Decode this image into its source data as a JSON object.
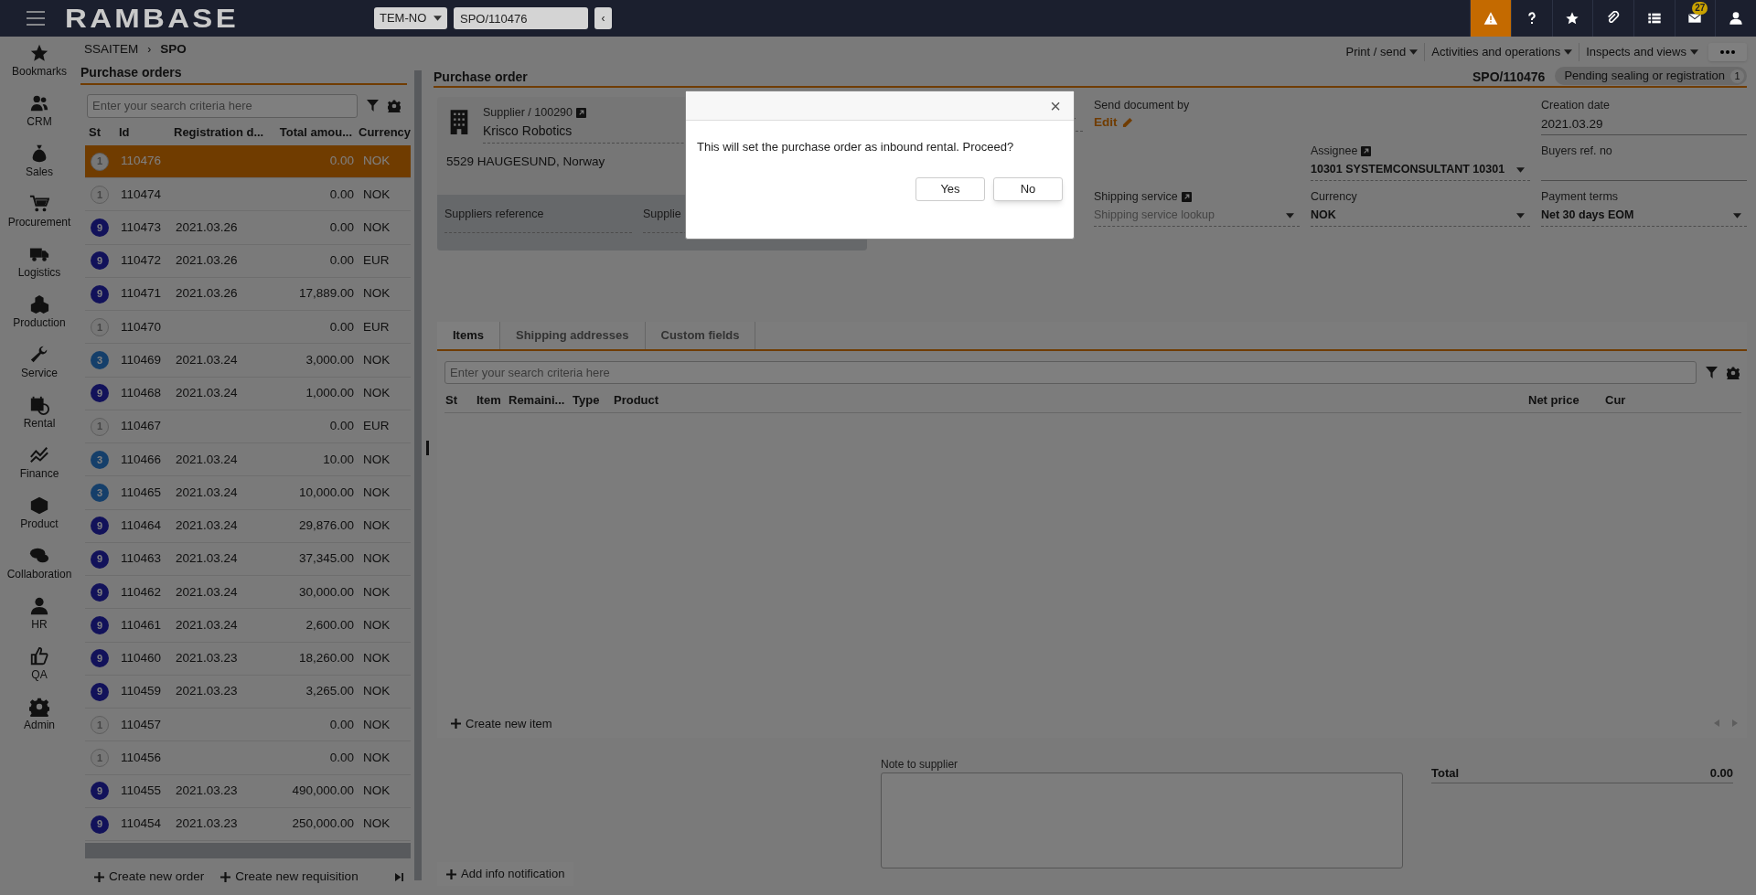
{
  "header": {
    "logo": "RAMBASE",
    "company": "TEM-NO",
    "document_field": "SPO/110476",
    "collapse_button": "‹",
    "toolbar": [
      {
        "kind": "alert",
        "selected": true
      },
      {
        "kind": "help",
        "selected": false
      },
      {
        "kind": "star",
        "selected": false
      },
      {
        "kind": "clip",
        "selected": false
      },
      {
        "kind": "list",
        "selected": false
      },
      {
        "kind": "mail",
        "selected": false,
        "badge": "27"
      },
      {
        "kind": "user",
        "selected": false
      }
    ]
  },
  "sidebar": [
    {
      "label": "Bookmarks",
      "kind": "star"
    },
    {
      "label": "CRM",
      "kind": "people"
    },
    {
      "label": "Sales",
      "kind": "money"
    },
    {
      "label": "Procurement",
      "kind": "cart"
    },
    {
      "label": "Logistics",
      "kind": "truck"
    },
    {
      "label": "Production",
      "kind": "boxes"
    },
    {
      "label": "Service",
      "kind": "wrench"
    },
    {
      "label": "Rental",
      "kind": "calendar"
    },
    {
      "label": "Finance",
      "kind": "chart"
    },
    {
      "label": "Product",
      "kind": "cube"
    },
    {
      "label": "Collaboration",
      "kind": "chat"
    },
    {
      "label": "HR",
      "kind": "person"
    },
    {
      "label": "QA",
      "kind": "thumb"
    },
    {
      "label": "Admin",
      "kind": "gear"
    }
  ],
  "breadcrumb": [
    "SSAITEM",
    "SPO"
  ],
  "breadcrumb_separator": "›",
  "list": {
    "title": "Purchase orders",
    "search_placeholder": "Enter your search criteria here",
    "columns": [
      "St",
      "Id",
      "Registration d...",
      "Total amou...",
      "Currency"
    ],
    "rows": [
      {
        "status": "1",
        "id": "110476",
        "date": "",
        "amount": "0.00",
        "currency": "NOK",
        "selected": true
      },
      {
        "status": "1",
        "id": "110474",
        "date": "",
        "amount": "0.00",
        "currency": "NOK",
        "selected": false
      },
      {
        "status": "9",
        "id": "110473",
        "date": "2021.03.26",
        "amount": "0.00",
        "currency": "NOK",
        "selected": false
      },
      {
        "status": "9",
        "id": "110472",
        "date": "2021.03.26",
        "amount": "0.00",
        "currency": "EUR",
        "selected": false
      },
      {
        "status": "9",
        "id": "110471",
        "date": "2021.03.26",
        "amount": "17,889.00",
        "currency": "NOK",
        "selected": false
      },
      {
        "status": "1",
        "id": "110470",
        "date": "",
        "amount": "0.00",
        "currency": "EUR",
        "selected": false
      },
      {
        "status": "3",
        "id": "110469",
        "date": "2021.03.24",
        "amount": "3,000.00",
        "currency": "NOK",
        "selected": false
      },
      {
        "status": "9",
        "id": "110468",
        "date": "2021.03.24",
        "amount": "1,000.00",
        "currency": "NOK",
        "selected": false
      },
      {
        "status": "1",
        "id": "110467",
        "date": "",
        "amount": "0.00",
        "currency": "EUR",
        "selected": false
      },
      {
        "status": "3",
        "id": "110466",
        "date": "2021.03.24",
        "amount": "10.00",
        "currency": "NOK",
        "selected": false
      },
      {
        "status": "3",
        "id": "110465",
        "date": "2021.03.24",
        "amount": "10,000.00",
        "currency": "NOK",
        "selected": false
      },
      {
        "status": "9",
        "id": "110464",
        "date": "2021.03.24",
        "amount": "29,876.00",
        "currency": "NOK",
        "selected": false
      },
      {
        "status": "9",
        "id": "110463",
        "date": "2021.03.24",
        "amount": "37,345.00",
        "currency": "NOK",
        "selected": false
      },
      {
        "status": "9",
        "id": "110462",
        "date": "2021.03.24",
        "amount": "30,000.00",
        "currency": "NOK",
        "selected": false
      },
      {
        "status": "9",
        "id": "110461",
        "date": "2021.03.24",
        "amount": "2,600.00",
        "currency": "NOK",
        "selected": false
      },
      {
        "status": "9",
        "id": "110460",
        "date": "2021.03.23",
        "amount": "18,260.00",
        "currency": "NOK",
        "selected": false
      },
      {
        "status": "9",
        "id": "110459",
        "date": "2021.03.23",
        "amount": "3,265.00",
        "currency": "NOK",
        "selected": false
      },
      {
        "status": "1",
        "id": "110457",
        "date": "",
        "amount": "0.00",
        "currency": "NOK",
        "selected": false
      },
      {
        "status": "1",
        "id": "110456",
        "date": "",
        "amount": "0.00",
        "currency": "NOK",
        "selected": false
      },
      {
        "status": "9",
        "id": "110455",
        "date": "2021.03.23",
        "amount": "490,000.00",
        "currency": "NOK",
        "selected": false
      },
      {
        "status": "9",
        "id": "110454",
        "date": "2021.03.23",
        "amount": "250,000.00",
        "currency": "NOK",
        "selected": false
      }
    ],
    "actions": [
      "Create new order",
      "Create new requisition"
    ]
  },
  "page_actions": [
    "Print / send",
    "Activities and operations",
    "Inspects and views"
  ],
  "document": {
    "title": "Purchase order",
    "number": "SPO/110476",
    "status": "Pending sealing or registration",
    "status_count": "1"
  },
  "supplier": {
    "label": "Supplier / 100290",
    "name": "Krisco Robotics",
    "address": "5529 HAUGESUND, Norway",
    "fields": [
      "Suppliers reference",
      "Supplie"
    ]
  },
  "send_document": {
    "label": "Send document by",
    "link": "Edit"
  },
  "creation_date": {
    "label": "Creation date",
    "value": "2021.03.29"
  },
  "assignee": {
    "label": "Assignee",
    "value": "10301 SYSTEMCONSULTANT 10301"
  },
  "buyers_ref": {
    "label": "Buyers ref. no"
  },
  "shipping_service": {
    "label": "Shipping service",
    "placeholder": "Shipping service lookup"
  },
  "currency": {
    "label": "Currency",
    "value": "NOK"
  },
  "payment_terms": {
    "label": "Payment terms",
    "value": "Net 30 days EOM"
  },
  "tabs": [
    {
      "label": "Items",
      "selected": true
    },
    {
      "label": "Shipping addresses",
      "selected": false
    },
    {
      "label": "Custom fields",
      "selected": false
    }
  ],
  "items": {
    "search_placeholder": "Enter your search criteria here",
    "columns": [
      "St",
      "Item",
      "Remaini...",
      "Type",
      "Product",
      "Net price",
      "Cur"
    ],
    "action": "Create new item"
  },
  "note": {
    "label": "Note to supplier"
  },
  "total": {
    "label": "Total",
    "value": "0.00"
  },
  "info_action": "Add info notification",
  "dialog": {
    "close": "×",
    "message": "This will set the purchase order as inbound rental. Proceed?",
    "buttons": [
      "Yes",
      "No"
    ]
  }
}
